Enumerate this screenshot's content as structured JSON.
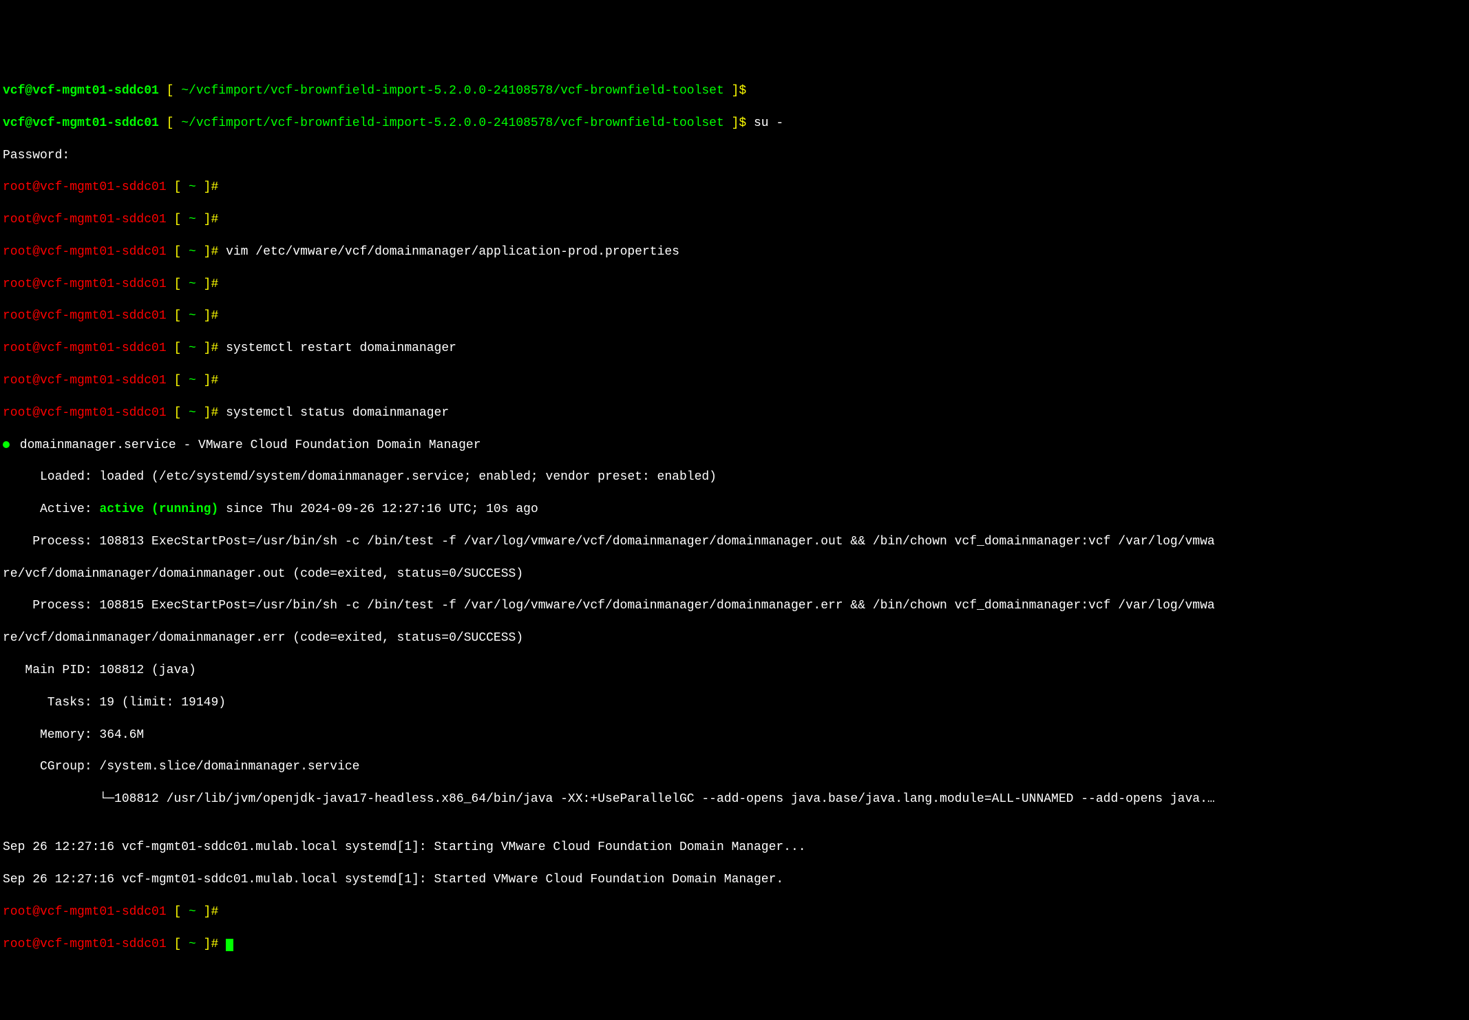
{
  "user_prompt": {
    "user_host": "vcf@vcf-mgmt01-sddc01",
    "bracket_open": " [ ",
    "path": "~/vcfimport/vcf-brownfield-import-5.2.0.0-24108578/vcf-brownfield-toolset",
    "bracket_close": " ]$ "
  },
  "root_prompt": {
    "user_host": "root@vcf-mgmt01-sddc01",
    "bracket_open": " [ ",
    "path": "~",
    "bracket_close": " ]# "
  },
  "commands": {
    "su": "su -",
    "vim": "vim /etc/vmware/vcf/domainmanager/application-prod.properties",
    "restart": "systemctl restart domainmanager",
    "status": "systemctl status domainmanager"
  },
  "password_label": "Password:",
  "status_output": {
    "service_line": " domainmanager.service - VMware Cloud Foundation Domain Manager",
    "loaded": "     Loaded: loaded (/etc/systemd/system/domainmanager.service; enabled; vendor preset: enabled)",
    "active_label": "     Active: ",
    "active_status": "active (running)",
    "active_since": " since Thu 2024-09-26 12:27:16 UTC; 10s ago",
    "process1": "    Process: 108813 ExecStartPost=/usr/bin/sh -c /bin/test -f /var/log/vmware/vcf/domainmanager/domainmanager.out && /bin/chown vcf_domainmanager:vcf /var/log/vmwa",
    "process1b": "re/vcf/domainmanager/domainmanager.out (code=exited, status=0/SUCCESS)",
    "process2": "    Process: 108815 ExecStartPost=/usr/bin/sh -c /bin/test -f /var/log/vmware/vcf/domainmanager/domainmanager.err && /bin/chown vcf_domainmanager:vcf /var/log/vmwa",
    "process2b": "re/vcf/domainmanager/domainmanager.err (code=exited, status=0/SUCCESS)",
    "main_pid": "   Main PID: 108812 (java)",
    "tasks": "      Tasks: 19 (limit: 19149)",
    "memory": "     Memory: 364.6M",
    "cgroup": "     CGroup: /system.slice/domainmanager.service",
    "cgroup_child": "             └─108812 /usr/lib/jvm/openjdk-java17-headless.x86_64/bin/java -XX:+UseParallelGC --add-opens java.base/java.lang.module=ALL-UNNAMED --add-opens java.…",
    "blank": "",
    "log1": "Sep 26 12:27:16 vcf-mgmt01-sddc01.mulab.local systemd[1]: Starting VMware Cloud Foundation Domain Manager...",
    "log2": "Sep 26 12:27:16 vcf-mgmt01-sddc01.mulab.local systemd[1]: Started VMware Cloud Foundation Domain Manager."
  }
}
